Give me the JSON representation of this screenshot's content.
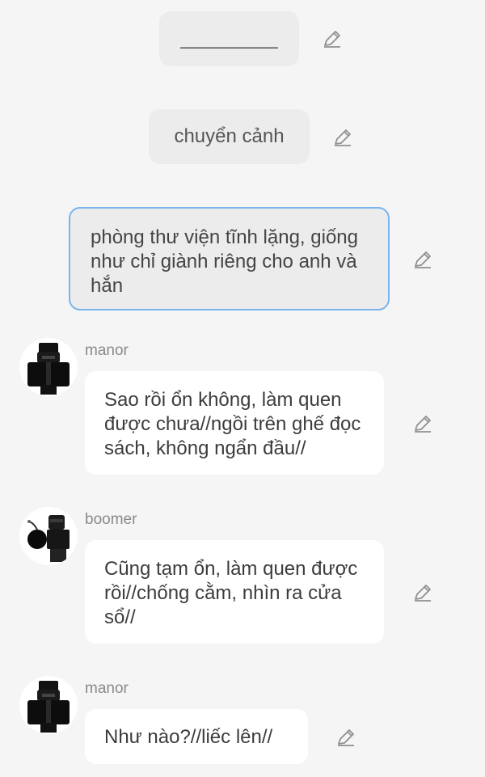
{
  "narrations": [
    {
      "text": "_________"
    },
    {
      "text": "chuyển cảnh"
    },
    {
      "text": "phòng thư viện tĩnh lặng, giống như chỉ giành riêng cho anh và hắn"
    }
  ],
  "messages": [
    {
      "sender": "manor",
      "text": "Sao rồi ổn không, làm quen được chưa//ngồi trên ghế đọc sách, không ngẩn đầu//"
    },
    {
      "sender": "boomer",
      "text": "Cũng tạm ổn, làm quen được rồi//chống cằm, nhìn ra cửa sổ//"
    },
    {
      "sender": "manor",
      "text": "Như nào?//liếc lên//"
    }
  ],
  "icons": {
    "edit": "pencil-icon",
    "avatar_manor": "manor-avatar",
    "avatar_boomer": "boomer-avatar"
  },
  "colors": {
    "background": "#f5f5f5",
    "narration_bubble": "#ececec",
    "message_bubble": "#ffffff",
    "selected_border": "#79b4ee",
    "sender_name": "#8a8a8a"
  }
}
